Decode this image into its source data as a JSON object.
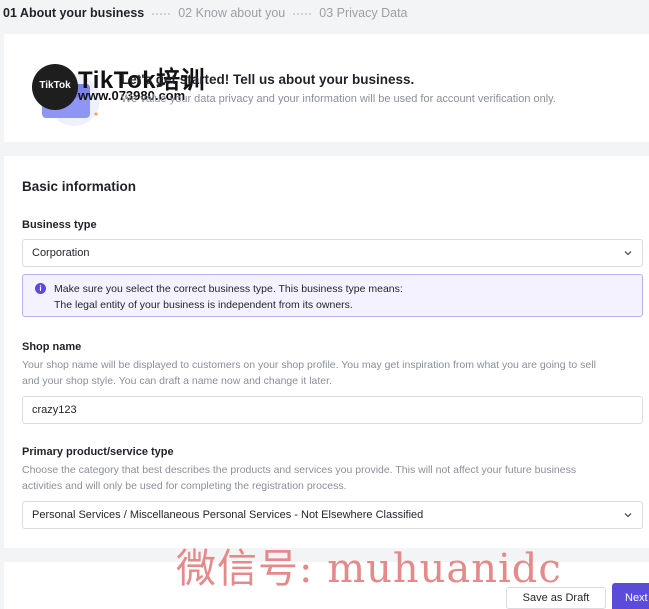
{
  "steps": [
    {
      "label": "01 About your business",
      "state": "active"
    },
    {
      "label": "02 Know about you",
      "state": "inactive"
    },
    {
      "label": "03 Privacy Data",
      "state": "inactive"
    }
  ],
  "intro": {
    "heading": "Let's get started! Tell us about your business.",
    "subtext": "We value your data privacy and your information will be used for account verification only."
  },
  "watermark": {
    "logo": "TikTok",
    "title": "TikTok培训",
    "url": "www.073980.com",
    "bottom": "微信号: muhuanidc"
  },
  "basic_info": {
    "title": "Basic information",
    "business_type": {
      "label": "Business type",
      "value": "Corporation",
      "notice_line1": "Make sure you select the correct business type. This business type means:",
      "notice_line2": "The legal entity of your business is independent from its owners."
    },
    "shop_name": {
      "label": "Shop name",
      "help_line1": "Your shop name will be displayed to customers on your shop profile. You may get inspiration from what you are going to sell",
      "help_line2": "and your shop style. You can draft a name now and change it later.",
      "value": "crazy123"
    },
    "primary_type": {
      "label": "Primary product/service type",
      "help_line1": "Choose the category that best describes the products and services you provide. This will not affect your future business",
      "help_line2": "activities and will only be used for completing the registration process.",
      "value": "Personal Services / Miscellaneous Personal Services - Not Elsewhere Classified"
    }
  },
  "footer": {
    "save_draft": "Save as Draft",
    "next": "Next"
  },
  "colors": {
    "accent": "#5b4bdb",
    "notice_bg": "#f4f2fe",
    "notice_border": "#b9b0ee"
  }
}
